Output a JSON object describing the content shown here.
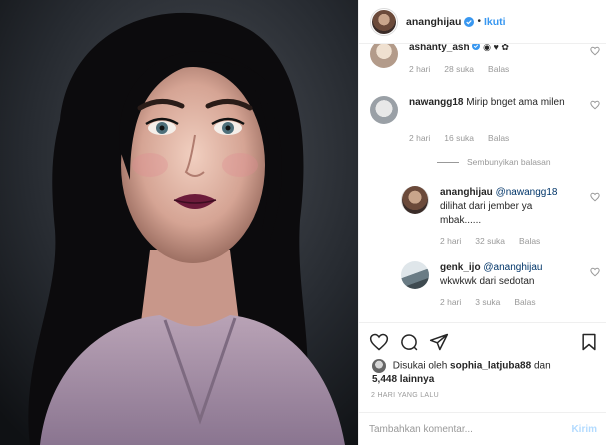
{
  "header": {
    "username": "ananghijau",
    "separator": "•",
    "follow_label": "Ikuti"
  },
  "comments": [
    {
      "user": "ashanty_ash",
      "text": "",
      "time": "2 hari",
      "likes": "28 suka",
      "reply_label": "Balas"
    },
    {
      "user": "nawangg18",
      "text": "Mirip bnget ama milen",
      "time": "2 hari",
      "likes": "16 suka",
      "reply_label": "Balas"
    }
  ],
  "hide_replies_label": "Sembunyikan balasan",
  "replies": [
    {
      "user": "ananghijau",
      "mention": "@nawangg18",
      "text": "dilihat dari jember ya mbak......",
      "time": "2 hari",
      "likes": "32 suka",
      "reply_label": "Balas"
    },
    {
      "user": "genk_ijo",
      "mention": "@ananghijau",
      "text": "wkwkwk dari sedotan",
      "time": "2 hari",
      "likes": "3 suka",
      "reply_label": "Balas"
    }
  ],
  "likes": {
    "prefix": "Disukai oleh",
    "user": "sophia_latjuba88",
    "connector": "dan",
    "count": "5,448 lainnya"
  },
  "timestamp": "2 HARI YANG LALU",
  "add_comment": {
    "placeholder": "Tambahkan komentar...",
    "post_label": "Kirim"
  },
  "colors": {
    "link": "#3897f0",
    "verified": "#3897f0",
    "post_disabled": "#b3dbff"
  },
  "icons": [
    "heart-icon",
    "comment-icon",
    "share-icon",
    "bookmark-icon",
    "verified-badge-icon",
    "more-emoji-icon"
  ]
}
